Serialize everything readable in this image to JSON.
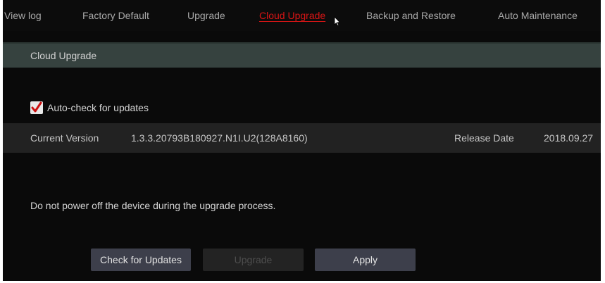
{
  "tabs": [
    {
      "label": "View log",
      "active": false
    },
    {
      "label": "Factory Default",
      "active": false
    },
    {
      "label": "Upgrade",
      "active": false
    },
    {
      "label": "Cloud Upgrade",
      "active": true
    },
    {
      "label": "Backup and Restore",
      "active": false
    },
    {
      "label": "Auto Maintenance",
      "active": false
    }
  ],
  "section": {
    "title": "Cloud Upgrade"
  },
  "auto_check": {
    "label": "Auto-check for updates",
    "checked": true
  },
  "version": {
    "current_label": "Current Version",
    "current_value": "1.3.3.20793B180927.N1I.U2(128A8160)",
    "release_label": "Release Date",
    "release_value": "2018.09.27"
  },
  "warning_text": "Do not power off the device during the upgrade process.",
  "buttons": {
    "check_label": "Check for Updates",
    "upgrade_label": "Upgrade",
    "apply_label": "Apply"
  },
  "colors": {
    "active_tab": "#d81515",
    "checkbox_mark": "#cc1010",
    "section_header_bg": "#36423f",
    "button_bg": "#3d3f4b"
  }
}
